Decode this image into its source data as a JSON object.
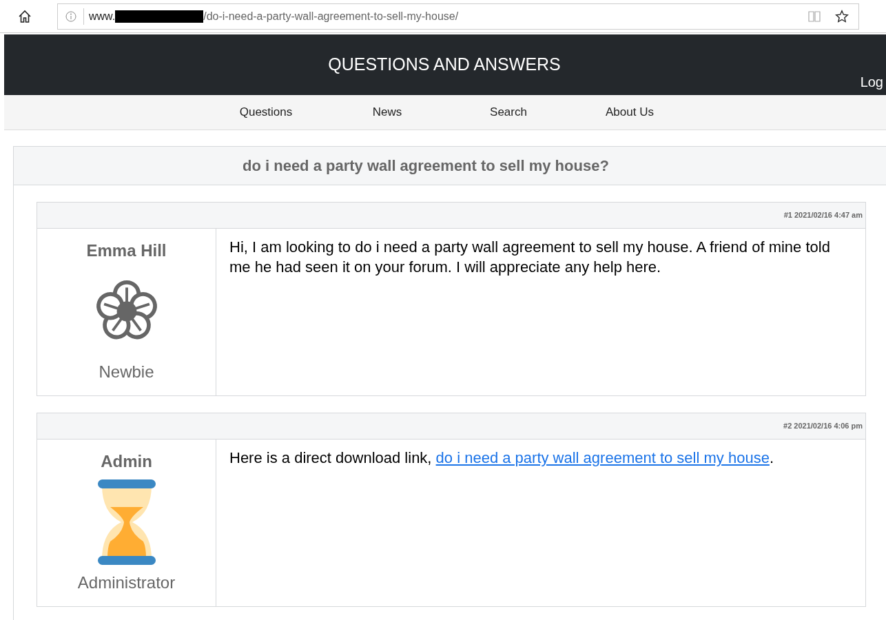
{
  "browser": {
    "url_prefix": "www.",
    "url_path": "/do-i-need-a-party-wall-agreement-to-sell-my-house/"
  },
  "header": {
    "title": "QUESTIONS AND ANSWERS",
    "login": "Log"
  },
  "nav": [
    {
      "label": "Questions"
    },
    {
      "label": "News"
    },
    {
      "label": "Search"
    },
    {
      "label": "About Us"
    }
  ],
  "question": {
    "title": "do i need a party wall agreement to sell my house?"
  },
  "posts": [
    {
      "meta": "#1 2021/02/16 4:47 am",
      "author": "Emma Hill",
      "rank": "Newbie",
      "kind": "member",
      "body": [
        {
          "kind": "text",
          "text": "Hi, I am looking to do i need a party wall agreement to sell my house. A friend of mine told me he had seen it on your forum. I will appreciate any help here."
        }
      ]
    },
    {
      "meta": "#2 2021/02/16 4:06 pm",
      "author": "Admin",
      "rank": "Administrator",
      "kind": "admin",
      "body": [
        {
          "kind": "text",
          "text": "Here is a direct download link, "
        },
        {
          "kind": "link",
          "text": "do i need a party wall agreement to sell my house"
        },
        {
          "kind": "text",
          "text": "."
        }
      ]
    }
  ]
}
